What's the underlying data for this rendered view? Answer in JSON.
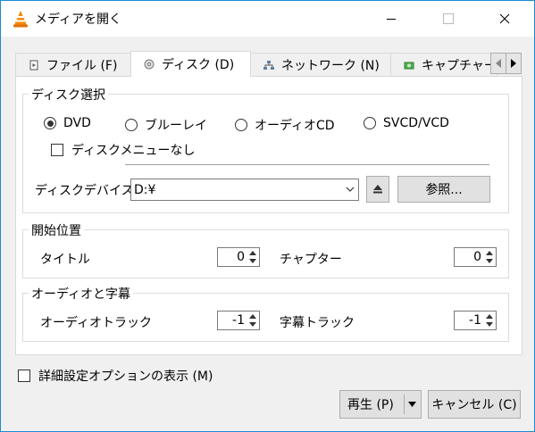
{
  "window": {
    "title": "メディアを開く"
  },
  "tabs": [
    {
      "label": "ファイル (F)",
      "icon": "file-icon"
    },
    {
      "label": "ディスク (D)",
      "icon": "disc-icon"
    },
    {
      "label": "ネットワーク (N)",
      "icon": "network-icon"
    },
    {
      "label": "キャプチャー",
      "icon": "capture-icon"
    }
  ],
  "disc_selection": {
    "title": "ディスク選択",
    "options": [
      "DVD",
      "ブルーレイ",
      "オーディオCD",
      "SVCD/VCD"
    ],
    "selected": "DVD",
    "no_menu_label": "ディスクメニューなし",
    "device_label": "ディスクデバイス",
    "device_value": "D:¥",
    "browse_label": "参照..."
  },
  "start_position": {
    "title": "開始位置",
    "title_label": "タイトル",
    "title_value": "0",
    "chapter_label": "チャプター",
    "chapter_value": "0"
  },
  "audio_subs": {
    "title": "オーディオと字幕",
    "audio_label": "オーディオトラック",
    "audio_value": "-1",
    "subtitle_label": "字幕トラック",
    "subtitle_value": "-1"
  },
  "footer": {
    "advanced_label": "詳細設定オプションの表示 (M)",
    "play_label": "再生 (P)",
    "cancel_label": "キャンセル (C)"
  },
  "colors": {
    "accent": "#1c8ad6",
    "vlc_orange": "#f28a00"
  }
}
